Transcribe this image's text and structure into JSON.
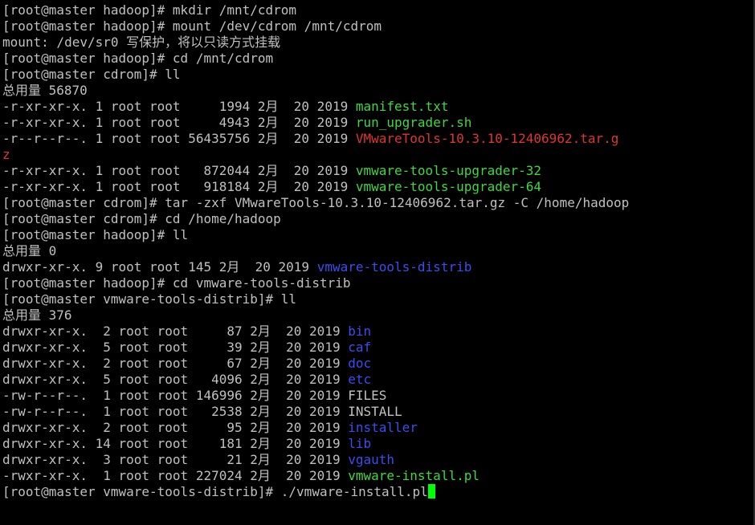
{
  "terminal": {
    "colors": {
      "background": "#000000",
      "text": "#c0c0c0",
      "green": "#3ed93e",
      "red": "#e03434",
      "blue": "#3b4df0",
      "cursor": "#00ff00"
    },
    "lines": [
      [
        {
          "t": "[root@master hadoop]# mkdir /mnt/cdrom"
        }
      ],
      [
        {
          "t": "[root@master hadoop]# mount /dev/cdrom /mnt/cdrom"
        }
      ],
      [
        {
          "t": "mount: /dev/sr0 写保护，将以只读方式挂载"
        }
      ],
      [
        {
          "t": "[root@master hadoop]# cd /mnt/cdrom"
        }
      ],
      [
        {
          "t": "[root@master cdrom]# ll"
        }
      ],
      [
        {
          "t": "总用量 56870"
        }
      ],
      [
        {
          "t": "-r-xr-xr-x. 1 root root     1994 2月  20 2019 "
        },
        {
          "t": "manifest.txt",
          "c": "green"
        }
      ],
      [
        {
          "t": "-r-xr-xr-x. 1 root root     4943 2月  20 2019 "
        },
        {
          "t": "run_upgrader.sh",
          "c": "green"
        }
      ],
      [
        {
          "t": "-r--r--r--. 1 root root 56435756 2月  20 2019 "
        },
        {
          "t": "VMwareTools-10.3.10-12406962.tar.g",
          "c": "red"
        }
      ],
      [
        {
          "t": "z",
          "c": "red"
        }
      ],
      [
        {
          "t": "-r-xr-xr-x. 1 root root   872044 2月  20 2019 "
        },
        {
          "t": "vmware-tools-upgrader-32",
          "c": "green"
        }
      ],
      [
        {
          "t": "-r-xr-xr-x. 1 root root   918184 2月  20 2019 "
        },
        {
          "t": "vmware-tools-upgrader-64",
          "c": "green"
        }
      ],
      [
        {
          "t": "[root@master cdrom]# tar -zxf VMwareTools-10.3.10-12406962.tar.gz -C /home/hadoop"
        }
      ],
      [
        {
          "t": "[root@master cdrom]# cd /home/hadoop"
        }
      ],
      [
        {
          "t": "[root@master hadoop]# ll"
        }
      ],
      [
        {
          "t": "总用量 0"
        }
      ],
      [
        {
          "t": "drwxr-xr-x. 9 root root 145 2月  20 2019 "
        },
        {
          "t": "vmware-tools-distrib",
          "c": "blue"
        }
      ],
      [
        {
          "t": "[root@master hadoop]# cd vmware-tools-distrib"
        }
      ],
      [
        {
          "t": "[root@master vmware-tools-distrib]# ll"
        }
      ],
      [
        {
          "t": "总用量 376"
        }
      ],
      [
        {
          "t": "drwxr-xr-x.  2 root root     87 2月  20 2019 "
        },
        {
          "t": "bin",
          "c": "blue"
        }
      ],
      [
        {
          "t": "drwxr-xr-x.  5 root root     39 2月  20 2019 "
        },
        {
          "t": "caf",
          "c": "blue"
        }
      ],
      [
        {
          "t": "drwxr-xr-x.  2 root root     67 2月  20 2019 "
        },
        {
          "t": "doc",
          "c": "blue"
        }
      ],
      [
        {
          "t": "drwxr-xr-x.  5 root root   4096 2月  20 2019 "
        },
        {
          "t": "etc",
          "c": "blue"
        }
      ],
      [
        {
          "t": "-rw-r--r--.  1 root root 146996 2月  20 2019 FILES"
        }
      ],
      [
        {
          "t": "-rw-r--r--.  1 root root   2538 2月  20 2019 INSTALL"
        }
      ],
      [
        {
          "t": "drwxr-xr-x.  2 root root     95 2月  20 2019 "
        },
        {
          "t": "installer",
          "c": "blue"
        }
      ],
      [
        {
          "t": "drwxr-xr-x. 14 root root    181 2月  20 2019 "
        },
        {
          "t": "lib",
          "c": "blue"
        }
      ],
      [
        {
          "t": "drwxr-xr-x.  3 root root     21 2月  20 2019 "
        },
        {
          "t": "vgauth",
          "c": "blue"
        }
      ],
      [
        {
          "t": "-rwxr-xr-x.  1 root root 227024 2月  20 2019 "
        },
        {
          "t": "vmware-install.pl",
          "c": "green"
        }
      ],
      [
        {
          "t": "[root@master vmware-tools-distrib]# ./vmware-install.pl"
        },
        {
          "cursor": true
        }
      ]
    ]
  }
}
